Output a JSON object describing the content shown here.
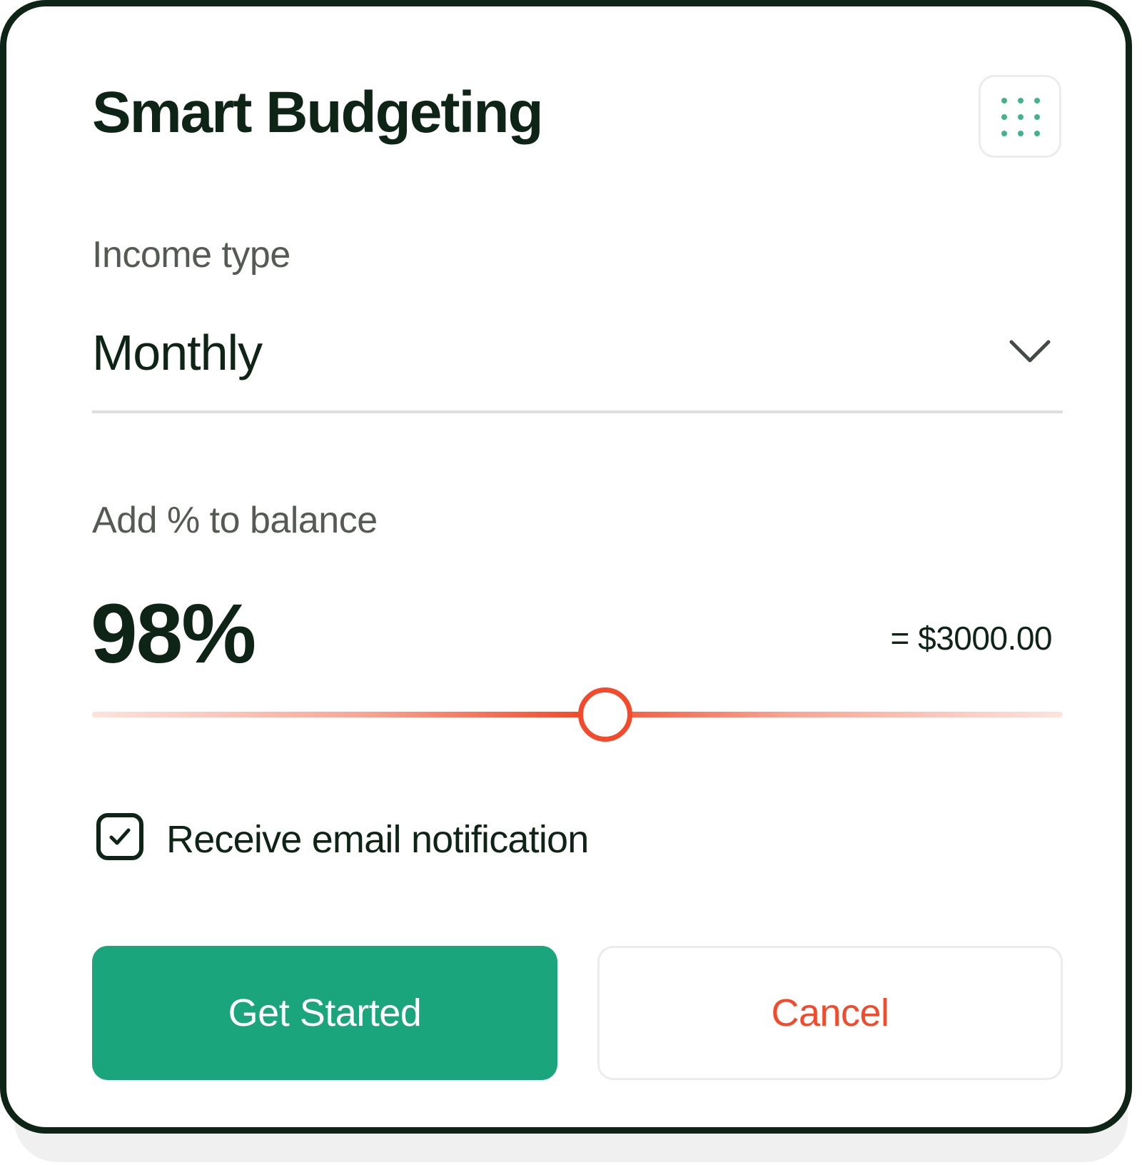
{
  "header": {
    "title": "Smart Budgeting",
    "menu_icon": "grid-dots-icon"
  },
  "income": {
    "label": "Income type",
    "selected_value": "Monthly",
    "dropdown_icon": "chevron-down-icon"
  },
  "balance": {
    "label": "Add % to balance",
    "percent_display": "98%",
    "amount_display": "= $3000.00",
    "slider_position": 0.529
  },
  "notification": {
    "checked": true,
    "label": "Receive email notification",
    "check_icon": "checkmark-icon"
  },
  "actions": {
    "primary_label": "Get Started",
    "secondary_label": "Cancel"
  },
  "colors": {
    "text_dark": "#0e2416",
    "text_muted": "#555a55",
    "primary": "#1aa57c",
    "accent_red": "#f44a2c",
    "dots": "#3fb48f",
    "divider": "#dedede"
  }
}
